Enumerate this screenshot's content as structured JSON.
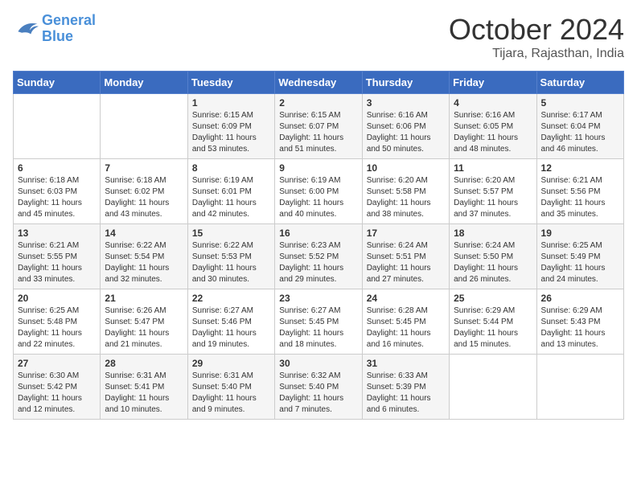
{
  "logo": {
    "general": "General",
    "blue": "Blue"
  },
  "header": {
    "month": "October 2024",
    "location": "Tijara, Rajasthan, India"
  },
  "weekdays": [
    "Sunday",
    "Monday",
    "Tuesday",
    "Wednesday",
    "Thursday",
    "Friday",
    "Saturday"
  ],
  "weeks": [
    [
      {
        "day": "",
        "sunrise": "",
        "sunset": "",
        "daylight": ""
      },
      {
        "day": "",
        "sunrise": "",
        "sunset": "",
        "daylight": ""
      },
      {
        "day": "1",
        "sunrise": "Sunrise: 6:15 AM",
        "sunset": "Sunset: 6:09 PM",
        "daylight": "Daylight: 11 hours and 53 minutes."
      },
      {
        "day": "2",
        "sunrise": "Sunrise: 6:15 AM",
        "sunset": "Sunset: 6:07 PM",
        "daylight": "Daylight: 11 hours and 51 minutes."
      },
      {
        "day": "3",
        "sunrise": "Sunrise: 6:16 AM",
        "sunset": "Sunset: 6:06 PM",
        "daylight": "Daylight: 11 hours and 50 minutes."
      },
      {
        "day": "4",
        "sunrise": "Sunrise: 6:16 AM",
        "sunset": "Sunset: 6:05 PM",
        "daylight": "Daylight: 11 hours and 48 minutes."
      },
      {
        "day": "5",
        "sunrise": "Sunrise: 6:17 AM",
        "sunset": "Sunset: 6:04 PM",
        "daylight": "Daylight: 11 hours and 46 minutes."
      }
    ],
    [
      {
        "day": "6",
        "sunrise": "Sunrise: 6:18 AM",
        "sunset": "Sunset: 6:03 PM",
        "daylight": "Daylight: 11 hours and 45 minutes."
      },
      {
        "day": "7",
        "sunrise": "Sunrise: 6:18 AM",
        "sunset": "Sunset: 6:02 PM",
        "daylight": "Daylight: 11 hours and 43 minutes."
      },
      {
        "day": "8",
        "sunrise": "Sunrise: 6:19 AM",
        "sunset": "Sunset: 6:01 PM",
        "daylight": "Daylight: 11 hours and 42 minutes."
      },
      {
        "day": "9",
        "sunrise": "Sunrise: 6:19 AM",
        "sunset": "Sunset: 6:00 PM",
        "daylight": "Daylight: 11 hours and 40 minutes."
      },
      {
        "day": "10",
        "sunrise": "Sunrise: 6:20 AM",
        "sunset": "Sunset: 5:58 PM",
        "daylight": "Daylight: 11 hours and 38 minutes."
      },
      {
        "day": "11",
        "sunrise": "Sunrise: 6:20 AM",
        "sunset": "Sunset: 5:57 PM",
        "daylight": "Daylight: 11 hours and 37 minutes."
      },
      {
        "day": "12",
        "sunrise": "Sunrise: 6:21 AM",
        "sunset": "Sunset: 5:56 PM",
        "daylight": "Daylight: 11 hours and 35 minutes."
      }
    ],
    [
      {
        "day": "13",
        "sunrise": "Sunrise: 6:21 AM",
        "sunset": "Sunset: 5:55 PM",
        "daylight": "Daylight: 11 hours and 33 minutes."
      },
      {
        "day": "14",
        "sunrise": "Sunrise: 6:22 AM",
        "sunset": "Sunset: 5:54 PM",
        "daylight": "Daylight: 11 hours and 32 minutes."
      },
      {
        "day": "15",
        "sunrise": "Sunrise: 6:22 AM",
        "sunset": "Sunset: 5:53 PM",
        "daylight": "Daylight: 11 hours and 30 minutes."
      },
      {
        "day": "16",
        "sunrise": "Sunrise: 6:23 AM",
        "sunset": "Sunset: 5:52 PM",
        "daylight": "Daylight: 11 hours and 29 minutes."
      },
      {
        "day": "17",
        "sunrise": "Sunrise: 6:24 AM",
        "sunset": "Sunset: 5:51 PM",
        "daylight": "Daylight: 11 hours and 27 minutes."
      },
      {
        "day": "18",
        "sunrise": "Sunrise: 6:24 AM",
        "sunset": "Sunset: 5:50 PM",
        "daylight": "Daylight: 11 hours and 26 minutes."
      },
      {
        "day": "19",
        "sunrise": "Sunrise: 6:25 AM",
        "sunset": "Sunset: 5:49 PM",
        "daylight": "Daylight: 11 hours and 24 minutes."
      }
    ],
    [
      {
        "day": "20",
        "sunrise": "Sunrise: 6:25 AM",
        "sunset": "Sunset: 5:48 PM",
        "daylight": "Daylight: 11 hours and 22 minutes."
      },
      {
        "day": "21",
        "sunrise": "Sunrise: 6:26 AM",
        "sunset": "Sunset: 5:47 PM",
        "daylight": "Daylight: 11 hours and 21 minutes."
      },
      {
        "day": "22",
        "sunrise": "Sunrise: 6:27 AM",
        "sunset": "Sunset: 5:46 PM",
        "daylight": "Daylight: 11 hours and 19 minutes."
      },
      {
        "day": "23",
        "sunrise": "Sunrise: 6:27 AM",
        "sunset": "Sunset: 5:45 PM",
        "daylight": "Daylight: 11 hours and 18 minutes."
      },
      {
        "day": "24",
        "sunrise": "Sunrise: 6:28 AM",
        "sunset": "Sunset: 5:45 PM",
        "daylight": "Daylight: 11 hours and 16 minutes."
      },
      {
        "day": "25",
        "sunrise": "Sunrise: 6:29 AM",
        "sunset": "Sunset: 5:44 PM",
        "daylight": "Daylight: 11 hours and 15 minutes."
      },
      {
        "day": "26",
        "sunrise": "Sunrise: 6:29 AM",
        "sunset": "Sunset: 5:43 PM",
        "daylight": "Daylight: 11 hours and 13 minutes."
      }
    ],
    [
      {
        "day": "27",
        "sunrise": "Sunrise: 6:30 AM",
        "sunset": "Sunset: 5:42 PM",
        "daylight": "Daylight: 11 hours and 12 minutes."
      },
      {
        "day": "28",
        "sunrise": "Sunrise: 6:31 AM",
        "sunset": "Sunset: 5:41 PM",
        "daylight": "Daylight: 11 hours and 10 minutes."
      },
      {
        "day": "29",
        "sunrise": "Sunrise: 6:31 AM",
        "sunset": "Sunset: 5:40 PM",
        "daylight": "Daylight: 11 hours and 9 minutes."
      },
      {
        "day": "30",
        "sunrise": "Sunrise: 6:32 AM",
        "sunset": "Sunset: 5:40 PM",
        "daylight": "Daylight: 11 hours and 7 minutes."
      },
      {
        "day": "31",
        "sunrise": "Sunrise: 6:33 AM",
        "sunset": "Sunset: 5:39 PM",
        "daylight": "Daylight: 11 hours and 6 minutes."
      },
      {
        "day": "",
        "sunrise": "",
        "sunset": "",
        "daylight": ""
      },
      {
        "day": "",
        "sunrise": "",
        "sunset": "",
        "daylight": ""
      }
    ]
  ]
}
